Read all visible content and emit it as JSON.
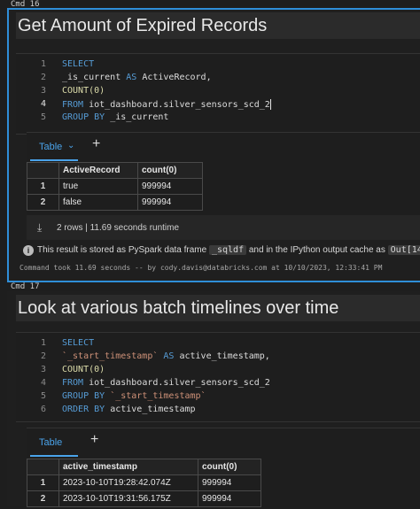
{
  "cells": {
    "c16": {
      "label": "Cmd 16",
      "title": "Get Amount of Expired Records",
      "lines": [
        {
          "n": "1"
        },
        {
          "n": "2"
        },
        {
          "n": "3"
        },
        {
          "n": "4"
        },
        {
          "n": "5"
        }
      ],
      "code": {
        "l1_kw": "SELECT",
        "l2_a": "_is_current ",
        "l2_kw": "AS",
        "l2_b": " ActiveRecord,",
        "l3_fn": "COUNT(0)",
        "l4_kw": "FROM",
        "l4_b": " iot_dashboard.silver_sensors_scd_2",
        "l5_kw": "GROUP BY",
        "l5_b": " _is_current"
      },
      "tab_label": "Table",
      "columns": [
        "ActiveRecord",
        "count(0)"
      ],
      "rows": [
        {
          "idx": "1",
          "a": "true",
          "b": "999994"
        },
        {
          "idx": "2",
          "a": "false",
          "b": "999994"
        }
      ],
      "footer": "2 rows  |  11.69 seconds runtime",
      "info_pre": "This result is stored as PySpark data frame ",
      "info_chip1": "_sqldf",
      "info_mid": " and in the IPython output cache as ",
      "info_chip2": "Out[14]",
      "took": "Command took 11.69 seconds -- by cody.davis@databricks.com at 10/10/2023, 12:33:41 PM"
    },
    "c17": {
      "label": "Cmd 17",
      "title": "Look at various batch timelines over time",
      "lines": [
        {
          "n": "1"
        },
        {
          "n": "2"
        },
        {
          "n": "3"
        },
        {
          "n": "4"
        },
        {
          "n": "5"
        },
        {
          "n": "6"
        }
      ],
      "code": {
        "l1_kw": "SELECT",
        "l2_str": "`_start_timestamp`",
        "l2_kw": "AS",
        "l2_b": " active_timestamp,",
        "l3_fn": "COUNT(0)",
        "l4_kw": "FROM",
        "l4_b": " iot_dashboard.silver_sensors_scd_2",
        "l5_kw": "GROUP BY",
        "l5_str": "`_start_timestamp`",
        "l6_kw": "ORDER BY",
        "l6_b": " active_timestamp"
      },
      "tab_label": "Table",
      "columns": [
        "active_timestamp",
        "count(0)"
      ],
      "rows": [
        {
          "idx": "1",
          "a": "2023-10-10T19:28:42.074Z",
          "b": "999994"
        },
        {
          "idx": "2",
          "a": "2023-10-10T19:31:56.175Z",
          "b": "999994"
        }
      ]
    }
  },
  "icons": {
    "tab_chevron": "chevron-down-icon",
    "add": "plus-icon",
    "download": "download-icon",
    "info": "info-icon"
  },
  "colors": {
    "accent": "#2f8ed8",
    "keyword": "#569cd6",
    "function": "#dcdcaa",
    "string": "#ce9178"
  }
}
